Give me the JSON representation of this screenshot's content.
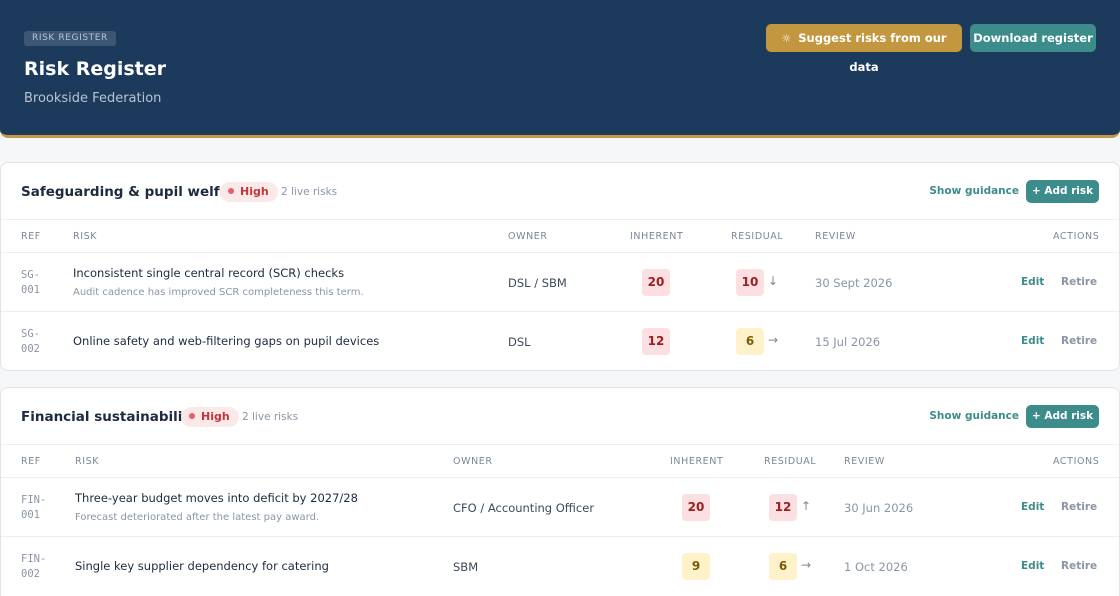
{
  "header": {
    "eyebrow": "RISK REGISTER",
    "title": "Risk Register",
    "subtitle": "Brookside Federation",
    "suggest_label": "Suggest risks from our data",
    "download_label": "Download register"
  },
  "colors": {
    "navy": "#1b3a5c",
    "gold": "#c39640",
    "teal": "#3c8c8c",
    "high_red": "#c0363b"
  },
  "columns": {
    "ref": "REF",
    "risk": "RISK",
    "owner": "OWNER",
    "inherent": "INHERENT",
    "residual": "RESIDUAL",
    "review": "REVIEW",
    "actions": "ACTIONS"
  },
  "sections": [
    {
      "title": "Safeguarding & pupil welfare",
      "level": "High",
      "live_count": "2 live risks",
      "guidance_label": "Show guidance",
      "add_label": "+ Add risk",
      "rows": [
        {
          "ref": "SG-001",
          "title": "Inconsistent single central record (SCR) checks",
          "note": "Audit cadence has improved SCR completeness this term.",
          "owner": "DSL / SBM",
          "inherent": "20",
          "residual": "10",
          "trend": "↓",
          "review": "30 Sept 2026",
          "edit": "Edit",
          "retire": "Retire"
        },
        {
          "ref": "SG-002",
          "title": "Online safety and web-filtering gaps on pupil devices",
          "note": "",
          "owner": "DSL",
          "inherent": "12",
          "residual": "6",
          "trend": "→",
          "review": "15 Jul 2026",
          "edit": "Edit",
          "retire": "Retire"
        }
      ]
    },
    {
      "title": "Financial sustainability",
      "level": "High",
      "live_count": "2 live risks",
      "guidance_label": "Show guidance",
      "add_label": "+ Add risk",
      "rows": [
        {
          "ref": "FIN-001",
          "title": "Three-year budget moves into deficit by 2027/28",
          "note": "Forecast deteriorated after the latest pay award.",
          "owner": "CFO / Accounting Officer",
          "inherent": "20",
          "residual": "12",
          "trend": "↑",
          "review": "30 Jun 2026",
          "edit": "Edit",
          "retire": "Retire"
        },
        {
          "ref": "FIN-002",
          "title": "Single key supplier dependency for catering",
          "note": "",
          "owner": "SBM",
          "inherent": "9",
          "residual": "6",
          "trend": "→",
          "review": "1 Oct 2026",
          "edit": "Edit",
          "retire": "Retire"
        }
      ]
    }
  ]
}
